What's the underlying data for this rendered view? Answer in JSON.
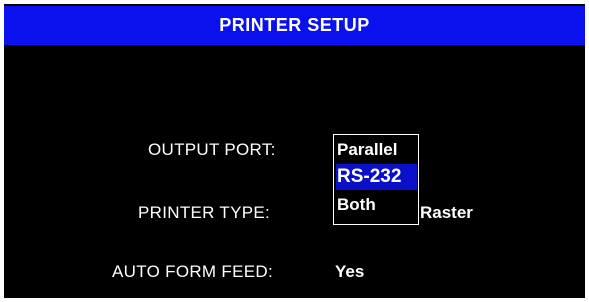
{
  "window": {
    "title": "PRINTER SETUP"
  },
  "fields": {
    "output_port": {
      "label": "OUTPUT PORT:"
    },
    "printer_type": {
      "label": "PRINTER TYPE:",
      "value_visible": "Raster"
    },
    "auto_form_feed": {
      "label": "AUTO FORM FEED:",
      "value": "Yes"
    }
  },
  "dropdown": {
    "items": [
      {
        "label": "Parallel",
        "selected": false
      },
      {
        "label": "RS-232",
        "selected": true
      },
      {
        "label": "Both",
        "selected": false
      }
    ]
  },
  "colors": {
    "title_bg": "#0a10ee",
    "screen_bg": "#000000",
    "text": "#ffffff",
    "selection_bg": "#0a10c8"
  }
}
